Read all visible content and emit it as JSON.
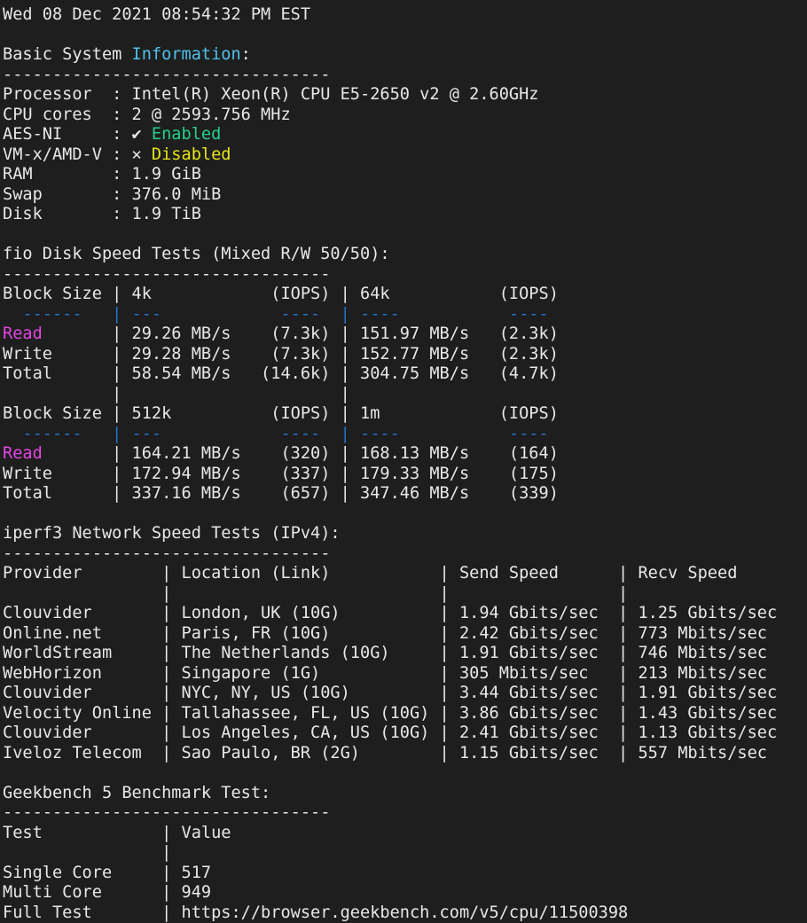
{
  "colors": {
    "background": "#1e1e1e",
    "text": "#e8e8e8",
    "information_word": "#4fc1e9",
    "enabled": "#23d18b",
    "disabled": "#e5e510",
    "read_label": "#e246e2",
    "table_separator": "#2472c8"
  },
  "lines": [
    {
      "spans": [
        {
          "t": "Wed 08 Dec 2021 08:54:32 PM EST"
        }
      ]
    },
    {
      "spans": []
    },
    {
      "spans": [
        {
          "t": "Basic System "
        },
        {
          "t": "Information",
          "c": "cyan"
        },
        {
          "t": ":"
        }
      ]
    },
    {
      "spans": [
        {
          "t": "---------------------------------"
        }
      ]
    },
    {
      "spans": [
        {
          "t": "Processor  : Intel(R) Xeon(R) CPU E5-2650 v2 @ 2.60GHz"
        }
      ]
    },
    {
      "spans": [
        {
          "t": "CPU cores  : 2 @ 2593.756 MHz"
        }
      ]
    },
    {
      "spans": [
        {
          "t": "AES-NI     : ✔ "
        },
        {
          "t": "Enabled",
          "c": "green"
        }
      ]
    },
    {
      "spans": [
        {
          "t": "VM-x/AMD-V : ✕ "
        },
        {
          "t": "Disabled",
          "c": "yellow"
        }
      ]
    },
    {
      "spans": [
        {
          "t": "RAM        : 1.9 GiB"
        }
      ]
    },
    {
      "spans": [
        {
          "t": "Swap       : 376.0 MiB"
        }
      ]
    },
    {
      "spans": [
        {
          "t": "Disk       : 1.9 TiB"
        }
      ]
    },
    {
      "spans": []
    },
    {
      "spans": [
        {
          "t": "fio Disk Speed Tests (Mixed R/W 50/50):"
        }
      ]
    },
    {
      "spans": [
        {
          "t": "---------------------------------"
        }
      ]
    },
    {
      "spans": [
        {
          "t": "Block Size | 4k            (IOPS) | 64k           (IOPS)"
        }
      ]
    },
    {
      "spans": [
        {
          "t": "  ------   | ---            ----  | ----           ---- ",
          "c": "blue"
        }
      ]
    },
    {
      "spans": [
        {
          "t": "Read",
          "c": "magenta"
        },
        {
          "t": "       | 29.26 MB/s    (7.3k) | 151.97 MB/s   (2.3k)"
        }
      ]
    },
    {
      "spans": [
        {
          "t": "Write      | 29.28 MB/s    (7.3k) | 152.77 MB/s   (2.3k)"
        }
      ]
    },
    {
      "spans": [
        {
          "t": "Total      | 58.54 MB/s   (14.6k) | 304.75 MB/s   (4.7k)"
        }
      ]
    },
    {
      "spans": [
        {
          "t": "           |                      |"
        }
      ]
    },
    {
      "spans": [
        {
          "t": "Block Size | 512k          (IOPS) | 1m            (IOPS)"
        }
      ]
    },
    {
      "spans": [
        {
          "t": "  ------   | ---            ----  | ----           ---- ",
          "c": "blue"
        }
      ]
    },
    {
      "spans": [
        {
          "t": "Read",
          "c": "magenta"
        },
        {
          "t": "       | 164.21 MB/s    (320) | 168.13 MB/s    (164)"
        }
      ]
    },
    {
      "spans": [
        {
          "t": "Write      | 172.94 MB/s    (337) | 179.33 MB/s    (175)"
        }
      ]
    },
    {
      "spans": [
        {
          "t": "Total      | 337.16 MB/s    (657) | 347.46 MB/s    (339)"
        }
      ]
    },
    {
      "spans": []
    },
    {
      "spans": [
        {
          "t": "iperf3 Network Speed Tests (IPv4):"
        }
      ]
    },
    {
      "spans": [
        {
          "t": "---------------------------------"
        }
      ]
    },
    {
      "spans": [
        {
          "t": "Provider        | Location (Link)           | Send Speed      | Recv Speed"
        }
      ]
    },
    {
      "spans": [
        {
          "t": "                |                           |                 |"
        }
      ]
    },
    {
      "spans": [
        {
          "t": "Clouvider       | London, UK (10G)          | 1.94 Gbits/sec  | 1.25 Gbits/sec"
        }
      ]
    },
    {
      "spans": [
        {
          "t": "Online.net      | Paris, FR (10G)           | 2.42 Gbits/sec  | 773 Mbits/sec"
        }
      ]
    },
    {
      "spans": [
        {
          "t": "WorldStream     | The Netherlands (10G)     | 1.91 Gbits/sec  | 746 Mbits/sec"
        }
      ]
    },
    {
      "spans": [
        {
          "t": "WebHorizon      | Singapore (1G)            | 305 Mbits/sec   | 213 Mbits/sec"
        }
      ]
    },
    {
      "spans": [
        {
          "t": "Clouvider       | NYC, NY, US (10G)         | 3.44 Gbits/sec  | 1.91 Gbits/sec"
        }
      ]
    },
    {
      "spans": [
        {
          "t": "Velocity Online | Tallahassee, FL, US (10G) | 3.86 Gbits/sec  | 1.43 Gbits/sec"
        }
      ]
    },
    {
      "spans": [
        {
          "t": "Clouvider       | Los Angeles, CA, US (10G) | 2.41 Gbits/sec  | 1.13 Gbits/sec"
        }
      ]
    },
    {
      "spans": [
        {
          "t": "Iveloz Telecom  | Sao Paulo, BR (2G)        | 1.15 Gbits/sec  | 557 Mbits/sec"
        }
      ]
    },
    {
      "spans": []
    },
    {
      "spans": [
        {
          "t": "Geekbench 5 Benchmark Test:"
        }
      ]
    },
    {
      "spans": [
        {
          "t": "---------------------------------"
        }
      ]
    },
    {
      "spans": [
        {
          "t": "Test            | Value"
        }
      ]
    },
    {
      "spans": [
        {
          "t": "                |"
        }
      ]
    },
    {
      "spans": [
        {
          "t": "Single Core     | 517"
        }
      ]
    },
    {
      "spans": [
        {
          "t": "Multi Core      | 949"
        }
      ]
    },
    {
      "spans": [
        {
          "t": "Full Test       | https://browser.geekbench.com/v5/cpu/11500398"
        }
      ]
    }
  ]
}
